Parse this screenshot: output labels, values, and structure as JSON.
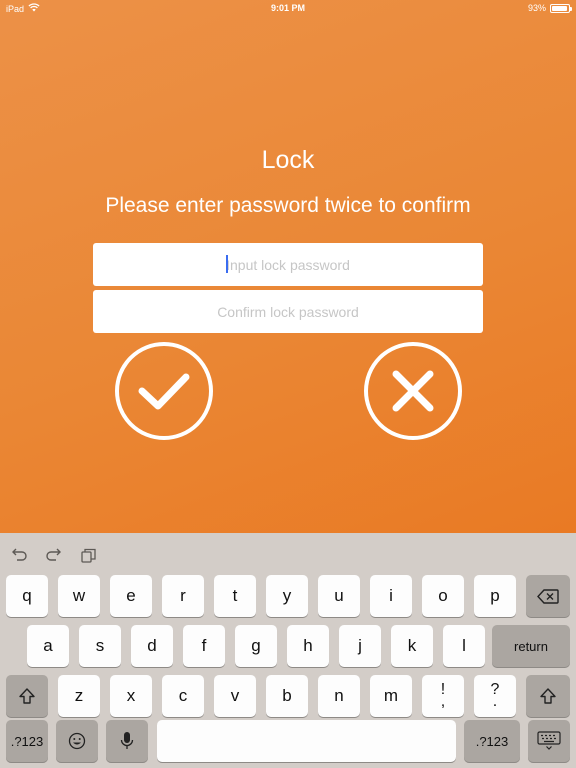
{
  "status_bar": {
    "device": "iPad",
    "time": "9:01 PM",
    "battery_text": "93%",
    "battery_level": 0.93
  },
  "lock": {
    "title": "Lock",
    "subtitle": "Please enter password twice to confirm",
    "password_placeholder": "Input lock password",
    "password_value": "",
    "confirm_placeholder": "Confirm lock password",
    "confirm_value": ""
  },
  "buttons": {
    "confirm_icon": "checkmark-icon",
    "cancel_icon": "x-icon"
  },
  "colors": {
    "accent_top": "#EC9147",
    "accent_bottom": "#E97A24",
    "caret": "#3A6CF0",
    "keyboard_bg": "#D3CDC8"
  },
  "keyboard": {
    "toolbar": [
      "undo-icon",
      "redo-icon",
      "paste-icon"
    ],
    "row1": [
      "q",
      "w",
      "e",
      "r",
      "t",
      "y",
      "u",
      "i",
      "o",
      "p"
    ],
    "row2": [
      "a",
      "s",
      "d",
      "f",
      "g",
      "h",
      "j",
      "k",
      "l"
    ],
    "row3": [
      "z",
      "x",
      "c",
      "v",
      "b",
      "n",
      "m"
    ],
    "punct1": [
      "!",
      ","
    ],
    "punct2": [
      "?",
      "."
    ],
    "return_label": "return",
    "numbers_label": ".?123"
  }
}
